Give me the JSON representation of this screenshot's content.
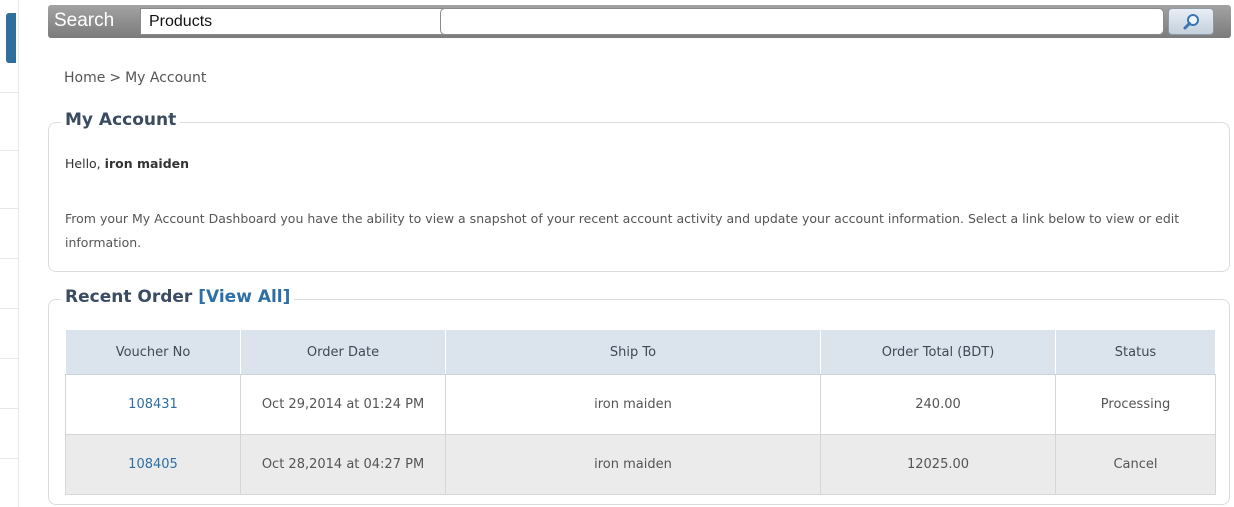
{
  "search": {
    "label": "Search",
    "category_selected": "Products",
    "input_value": "",
    "button_icon": "magnifier-icon"
  },
  "breadcrumb": {
    "home": "Home",
    "separator": ">",
    "current": "My Account"
  },
  "account": {
    "title": "My Account",
    "greeting_prefix": "Hello,",
    "user_name": "iron maiden",
    "intro": "From your My Account Dashboard you have the ability to view a snapshot of your recent account activity and update your account information. Select a link below to view or edit information."
  },
  "orders": {
    "title": "Recent Order",
    "view_all": "[View All]",
    "columns": [
      "Voucher No",
      "Order Date",
      "Ship To",
      "Order Total (BDT)",
      "Status"
    ],
    "rows": [
      {
        "voucher": "108431",
        "date": "Oct 29,2014 at 01:24 PM",
        "ship_to": "iron maiden",
        "total": "240.00",
        "status": "Processing"
      },
      {
        "voucher": "108405",
        "date": "Oct 28,2014 at 04:27 PM",
        "ship_to": "iron maiden",
        "total": "12025.00",
        "status": "Cancel"
      }
    ]
  },
  "colors": {
    "header_row": "#dbe4ed",
    "link": "#2e6fa5",
    "title": "#3b4b62",
    "search_bar": "#8c8c8c"
  }
}
